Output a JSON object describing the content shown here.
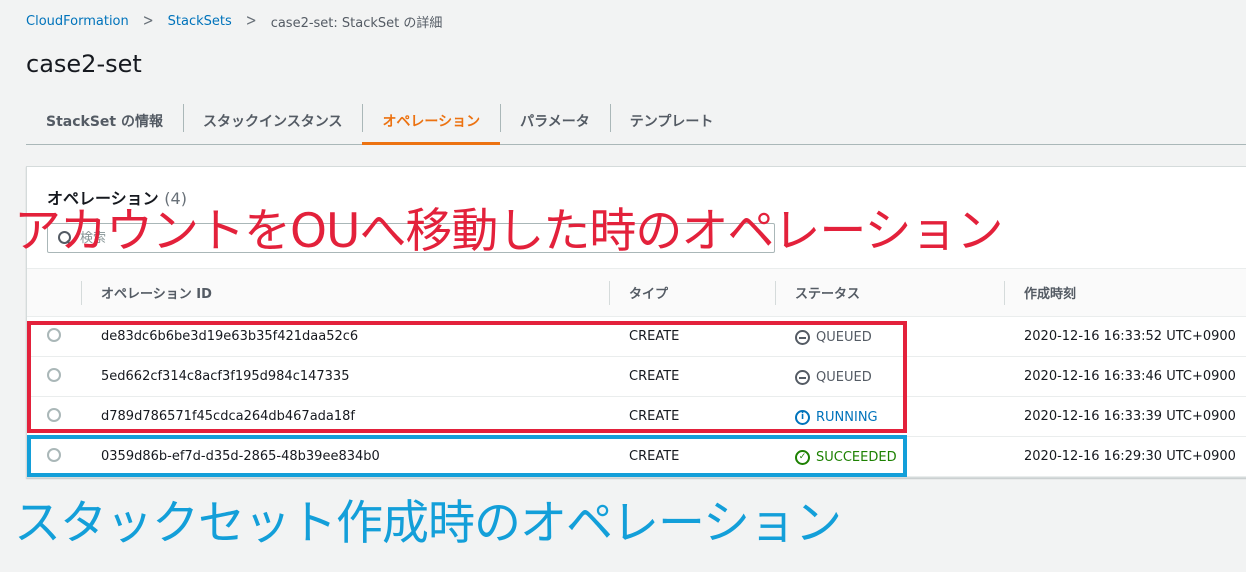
{
  "breadcrumb": {
    "items": [
      {
        "label": "CloudFormation"
      },
      {
        "label": "StackSets"
      },
      {
        "label": "case2-set: StackSet の詳細"
      }
    ],
    "separator": ">"
  },
  "page": {
    "title": "case2-set"
  },
  "tabs": [
    {
      "label": "StackSet の情報",
      "active": false
    },
    {
      "label": "スタックインスタンス",
      "active": false
    },
    {
      "label": "オペレーション",
      "active": true
    },
    {
      "label": "パラメータ",
      "active": false
    },
    {
      "label": "テンプレート",
      "active": false
    }
  ],
  "panel": {
    "title": "オペレーション",
    "count": "(4)",
    "search_placeholder": "検索"
  },
  "table": {
    "columns": [
      "オペレーション ID",
      "タイプ",
      "ステータス",
      "作成時刻"
    ],
    "rows": [
      {
        "id": "de83dc6b6be3d19e63b35f421daa52c6",
        "type": "CREATE",
        "status": "QUEUED",
        "created": "2020-12-16 16:33:52 UTC+0900"
      },
      {
        "id": "5ed662cf314c8acf3f195d984c147335",
        "type": "CREATE",
        "status": "QUEUED",
        "created": "2020-12-16 16:33:46 UTC+0900"
      },
      {
        "id": "d789d786571f45cdca264db467ada18f",
        "type": "CREATE",
        "status": "RUNNING",
        "created": "2020-12-16 16:33:39 UTC+0900"
      },
      {
        "id": "0359d86b-ef7d-d35d-2865-48b39ee834b0",
        "type": "CREATE",
        "status": "SUCCEEDED",
        "created": "2020-12-16 16:29:30 UTC+0900"
      }
    ]
  },
  "annotations": {
    "red_text": "アカウントをOUへ移動した時のオペレーション",
    "blue_text": "スタックセット作成時のオペレーション",
    "red_color": "#e3213b",
    "blue_color": "#139fd9"
  },
  "colors": {
    "link": "#0073bb",
    "accent": "#ec7211",
    "running": "#0073bb",
    "succeeded": "#1d8102",
    "queued": "#545b64"
  }
}
